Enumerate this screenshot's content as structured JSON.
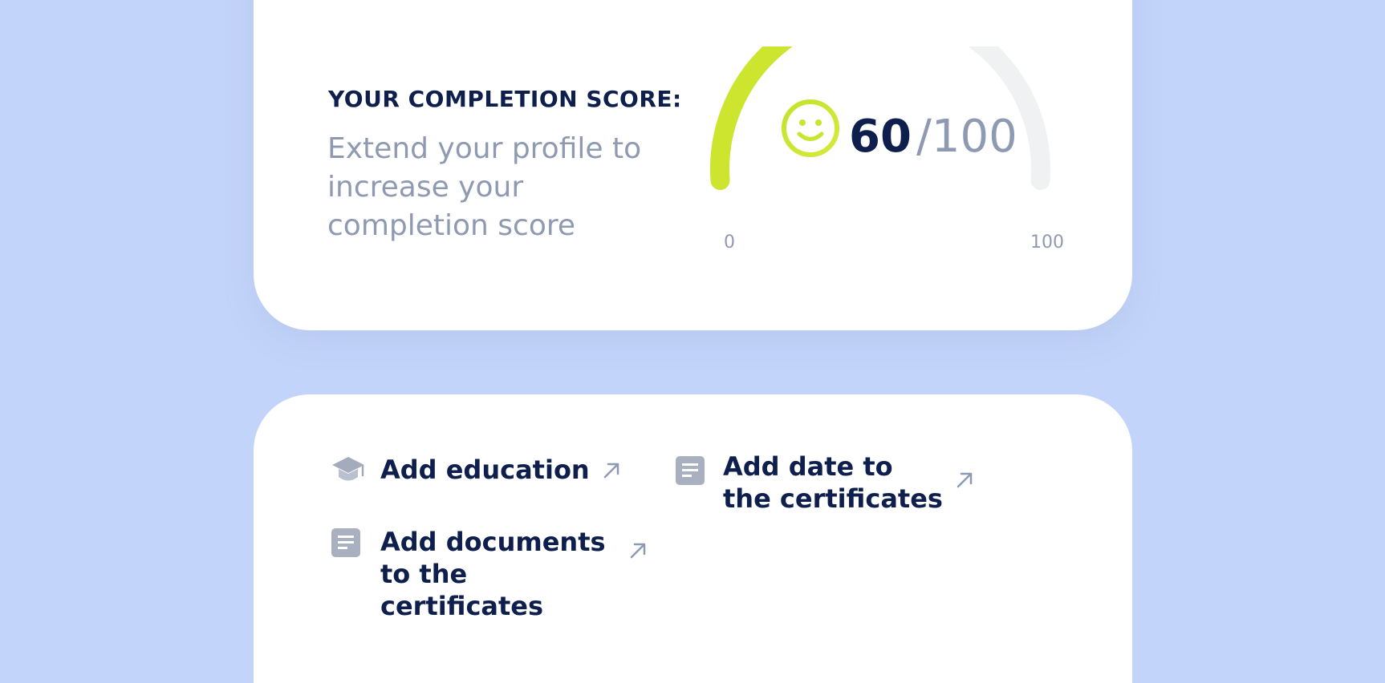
{
  "score_card": {
    "title": "YOUR COMPLETION SCORE:",
    "description": "Extend your profile to increase your completion score",
    "score": "60",
    "slash": "/",
    "max": "100",
    "scale_min": "0",
    "scale_max": "100",
    "progress_fraction": 0.6,
    "mood_icon": "smiley-icon"
  },
  "actions": [
    {
      "label": "Add education",
      "icon": "graduation-cap-icon"
    },
    {
      "label": "Add date to the certificates",
      "icon": "document-icon"
    },
    {
      "label": "Add documents to the certificates",
      "icon": "document-icon"
    }
  ],
  "colors": {
    "background": "#c3d4fa",
    "card": "#ffffff",
    "accent": "#cde52e",
    "text_dark": "#0e1f4d",
    "text_muted": "#8e9ab2",
    "track": "#f0f1f3"
  }
}
